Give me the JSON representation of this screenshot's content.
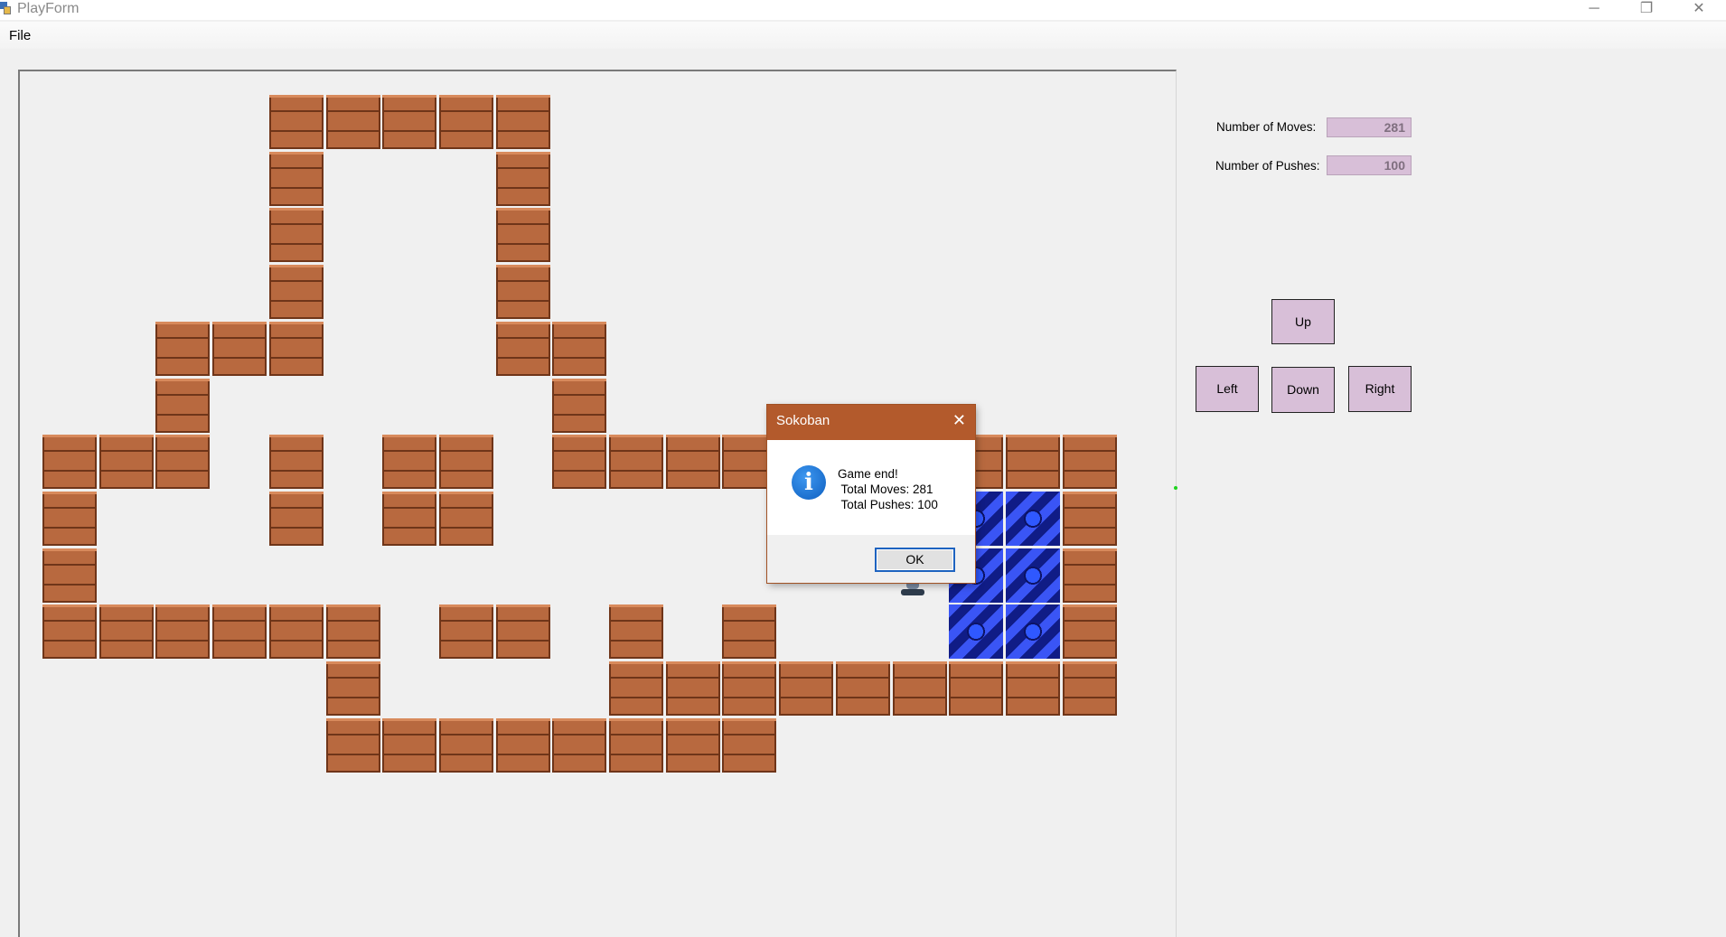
{
  "window": {
    "title": "PlayForm",
    "controls": [
      "─",
      "❐",
      "✕"
    ]
  },
  "menu": {
    "file_label": "File"
  },
  "stats": {
    "moves_label": "Number of Moves:",
    "moves_value": "281",
    "pushes_label": "Number of Pushes:",
    "pushes_value": "100"
  },
  "controls": {
    "up": "Up",
    "left": "Left",
    "down": "Down",
    "right": "Right"
  },
  "dialog": {
    "title": "Sokoban",
    "close_glyph": "✕",
    "icon_glyph": "i",
    "line1": "Game end!",
    "line2": " Total Moves: 281",
    "line3": " Total Pushes: 100",
    "ok_label": "OK"
  },
  "colors": {
    "button_fill": "#d8bfd8",
    "dialog_title": "#b35a2c",
    "wall": "#b8693f",
    "goal": "#1a2a9e"
  },
  "board": {
    "walls": [
      [
        0,
        4
      ],
      [
        0,
        5
      ],
      [
        0,
        6
      ],
      [
        0,
        7
      ],
      [
        0,
        8
      ],
      [
        1,
        4
      ],
      [
        1,
        8
      ],
      [
        2,
        4
      ],
      [
        2,
        8
      ],
      [
        3,
        4
      ],
      [
        3,
        8
      ],
      [
        4,
        2
      ],
      [
        4,
        3
      ],
      [
        4,
        4
      ],
      [
        4,
        8
      ],
      [
        4,
        9
      ],
      [
        5,
        2
      ],
      [
        5,
        9
      ],
      [
        6,
        0
      ],
      [
        6,
        1
      ],
      [
        6,
        2
      ],
      [
        6,
        4
      ],
      [
        6,
        6
      ],
      [
        6,
        7
      ],
      [
        6,
        9
      ],
      [
        6,
        10
      ],
      [
        6,
        11
      ],
      [
        6,
        12
      ],
      [
        6,
        13
      ],
      [
        6,
        14
      ],
      [
        6,
        15
      ],
      [
        6,
        16
      ],
      [
        6,
        17
      ],
      [
        6,
        18
      ],
      [
        7,
        0
      ],
      [
        7,
        4
      ],
      [
        7,
        6
      ],
      [
        7,
        7
      ],
      [
        7,
        18
      ],
      [
        8,
        0
      ],
      [
        8,
        18
      ],
      [
        9,
        0
      ],
      [
        9,
        1
      ],
      [
        9,
        2
      ],
      [
        9,
        3
      ],
      [
        9,
        4
      ],
      [
        9,
        5
      ],
      [
        9,
        7
      ],
      [
        9,
        8
      ],
      [
        9,
        10
      ],
      [
        9,
        12
      ],
      [
        9,
        18
      ],
      [
        10,
        5
      ],
      [
        10,
        10
      ],
      [
        10,
        11
      ],
      [
        10,
        12
      ],
      [
        10,
        13
      ],
      [
        10,
        14
      ],
      [
        10,
        15
      ],
      [
        10,
        16
      ],
      [
        10,
        17
      ],
      [
        10,
        18
      ],
      [
        11,
        5
      ],
      [
        11,
        6
      ],
      [
        11,
        7
      ],
      [
        11,
        8
      ],
      [
        11,
        9
      ],
      [
        11,
        10
      ],
      [
        11,
        11
      ],
      [
        11,
        12
      ]
    ],
    "goals": [
      [
        7,
        16
      ],
      [
        7,
        17
      ],
      [
        8,
        16
      ],
      [
        8,
        17
      ],
      [
        9,
        16
      ],
      [
        9,
        17
      ]
    ],
    "player": [
      8,
      15
    ]
  }
}
